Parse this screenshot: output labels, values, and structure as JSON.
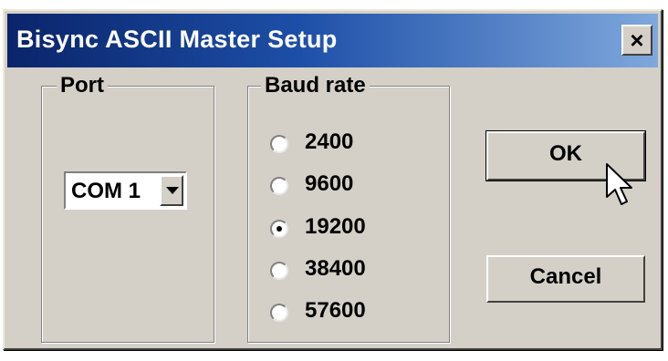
{
  "window": {
    "title": "Bisync ASCII Master Setup",
    "close_label": "×"
  },
  "port": {
    "group_label": "Port",
    "selected": "COM 1"
  },
  "baud": {
    "group_label": "Baud rate",
    "options": [
      {
        "label": "2400",
        "checked": false
      },
      {
        "label": "9600",
        "checked": false
      },
      {
        "label": "19200",
        "checked": true
      },
      {
        "label": "38400",
        "checked": false
      },
      {
        "label": "57600",
        "checked": false
      }
    ]
  },
  "buttons": {
    "ok_label": "OK",
    "cancel_label": "Cancel"
  },
  "colors": {
    "title_bar_start": "#0a246a",
    "title_bar_end": "#7fa8dc",
    "face": "#d4d0c8"
  },
  "icons": {
    "cursor": "arrow-pointer"
  }
}
